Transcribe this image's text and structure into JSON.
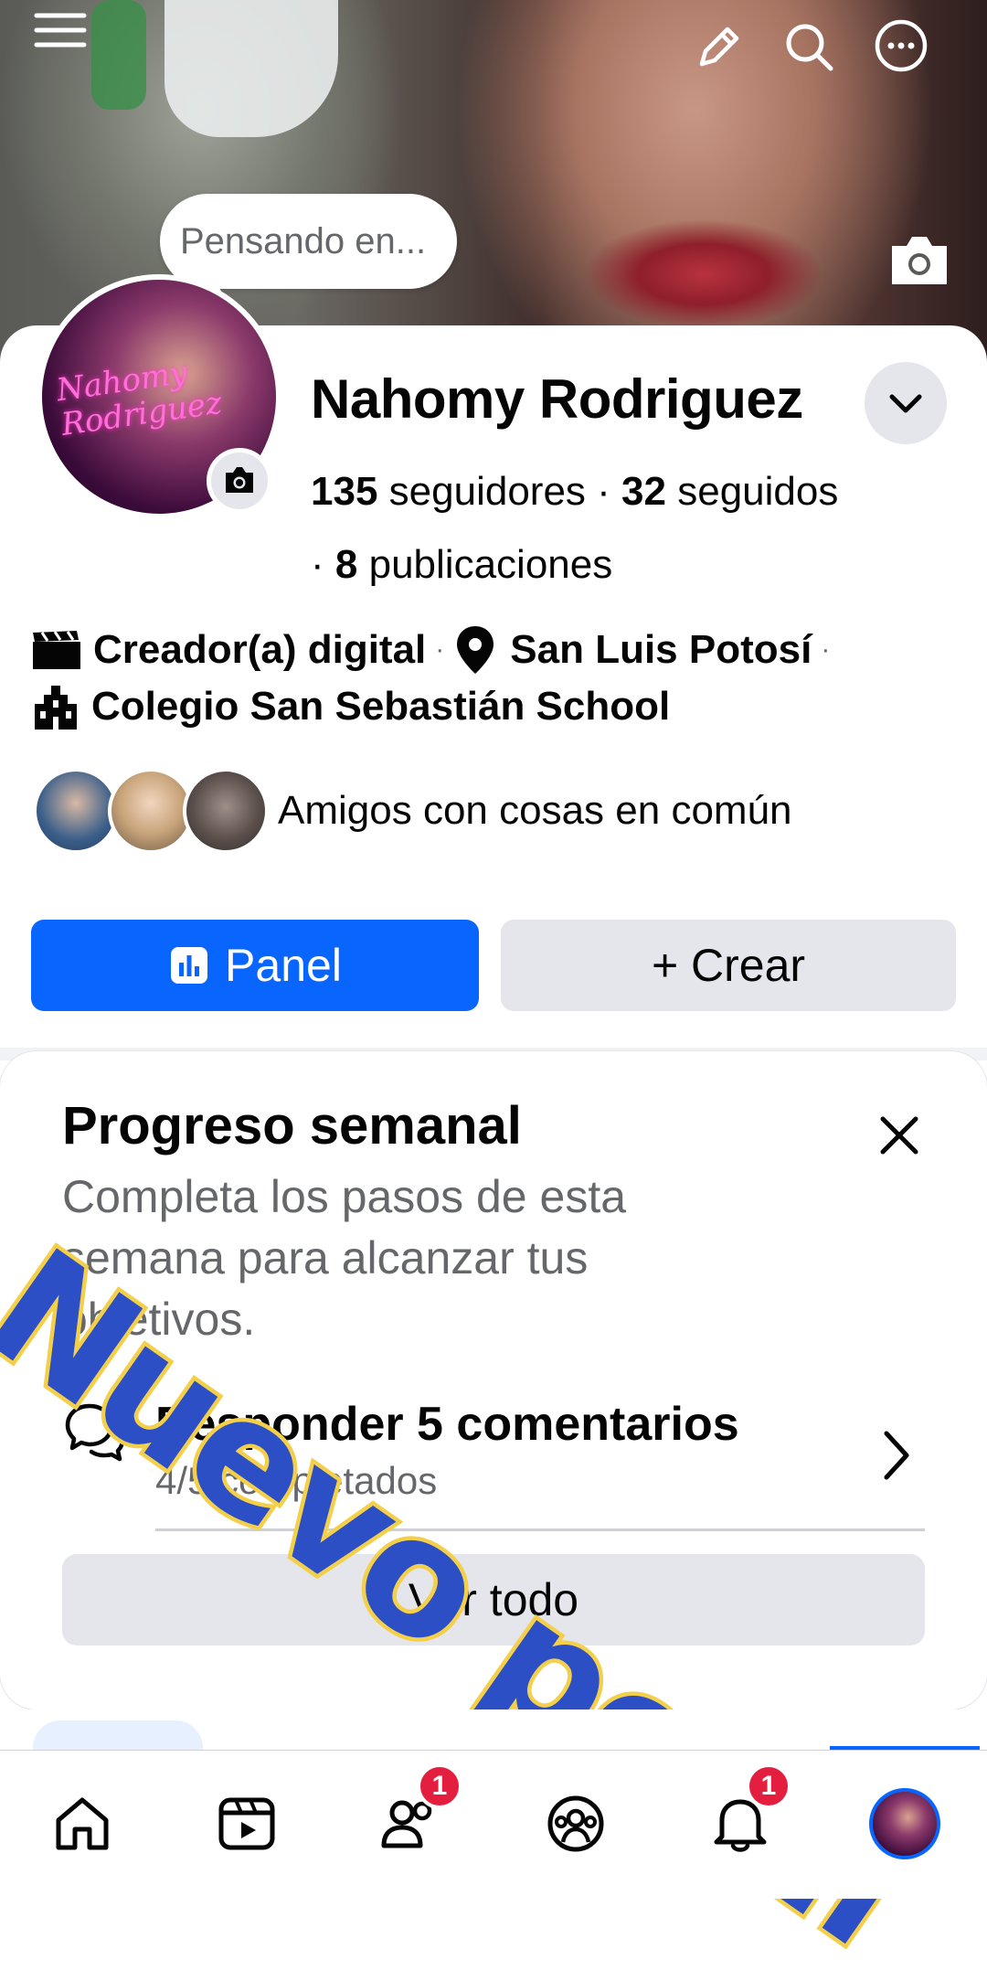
{
  "cover": {
    "thought_placeholder": "Pensando en..."
  },
  "profile": {
    "avatar_signature_line1": "Nahomy",
    "avatar_signature_line2": "Rodriguez",
    "name": "Nahomy Rodriguez",
    "followers_count": "135",
    "followers_label": "seguidores",
    "following_count": "32",
    "following_label": "seguidos",
    "posts_count": "8",
    "posts_label": "publicaciones",
    "separator": "·"
  },
  "details": {
    "category": "Creador(a) digital",
    "location": "San Luis Potosí",
    "school": "Colegio San Sebastián School"
  },
  "friends": {
    "label": "Amigos con cosas en común"
  },
  "actions": {
    "panel_label": "Panel",
    "create_label": "+ Crear"
  },
  "weekly": {
    "title": "Progreso semanal",
    "description": "Completa los pasos de esta semana para alcanzar tus objetivos.",
    "task_title": "Responder 5 comentarios",
    "task_progress": "4/5 completados",
    "task_progress_fraction": 0.8,
    "see_all_label": "Ver todo"
  },
  "overlay": {
    "text": "Nuevo perfil",
    "fill_color": "#2c4fc6",
    "stroke_color": "#f3cf4a"
  },
  "nav": {
    "items": [
      "home-icon",
      "video-icon",
      "friends-icon",
      "groups-icon",
      "bell-icon",
      "profile-avatar"
    ],
    "friends_badge": "1",
    "notifications_badge": "1"
  },
  "colors": {
    "accent": "#0866ff",
    "badge": "#e41e3f",
    "secondary_button": "#e4e6eb"
  }
}
